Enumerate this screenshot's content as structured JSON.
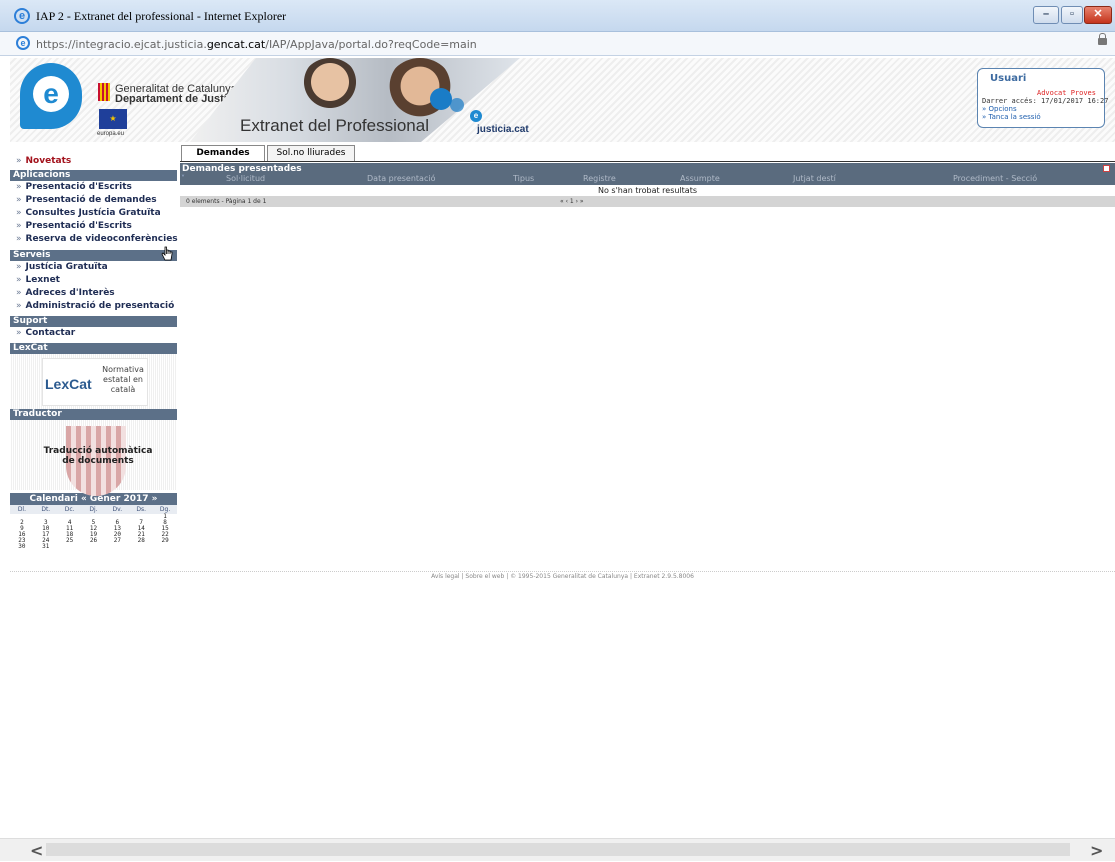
{
  "window": {
    "title": "IAP 2 - Extranet del professional - Internet Explorer",
    "url_prefix": "https://integracio.ejcat.justicia.",
    "url_domain": "gencat.cat",
    "url_suffix": "/IAP/AppJava/portal.do?reqCode=main",
    "minimize": "–",
    "maximize": "▫",
    "close": "✕"
  },
  "banner": {
    "logo_letter": "e",
    "gencat_line1": "Generalitat de Catalunya",
    "gencat_line2": "Departament de Justícia",
    "eu_label": "europa.eu",
    "title": "Extranet del Professional",
    "jcat": "justicia.cat"
  },
  "user": {
    "title": "Usuari",
    "name": "Advocat Proves",
    "last_access": "Darrer accés: 17/01/2017 16:27",
    "options": "» Opcions",
    "logout": "» Tanca la sessió"
  },
  "sidebar": {
    "novetats": "Novetats",
    "aplicacions_head": "Aplicacions",
    "aplicacions": [
      "Presentació d'Escrits",
      "Presentació de demandes",
      "Consultes Justícia Gratuïta",
      "Presentació d'Escrits",
      "Reserva de videoconferències"
    ],
    "serveis_head": "Serveis",
    "serveis": [
      "Justícia Gratuïta",
      "Lexnet",
      "Adreces d'Interès",
      "Administració de presentació"
    ],
    "suport_head": "Suport",
    "suport": [
      "Contactar"
    ],
    "lexcat_head": "LexCat",
    "lexcat_logo": "LexCat",
    "lexcat_text": "Normativa estatal en català",
    "traductor_head": "Traductor",
    "traductor_text": "Traducció automàtica de documents",
    "raquo": "»"
  },
  "calendar": {
    "title": "Calendari « Gener 2017 »",
    "days": [
      "Dl.",
      "Dt.",
      "Dc.",
      "Dj.",
      "Dv.",
      "Ds.",
      "Dg."
    ],
    "cells": [
      "",
      "",
      "",
      "",
      "",
      "",
      "1",
      "2",
      "3",
      "4",
      "5",
      "6",
      "7",
      "8",
      "9",
      "10",
      "11",
      "12",
      "13",
      "14",
      "15",
      "16",
      "17",
      "18",
      "19",
      "20",
      "21",
      "22",
      "23",
      "24",
      "25",
      "26",
      "27",
      "28",
      "29",
      "30",
      "31",
      "",
      "",
      "",
      "",
      ""
    ]
  },
  "main": {
    "tabs": [
      "Demandes",
      "Sol.no lliurades"
    ],
    "section_title": "Demandes presentades",
    "sort_icon": "˅",
    "columns": [
      "Sol·licitud",
      "Data presentació",
      "Tipus",
      "Registre",
      "Assumpte",
      "Jutjat destí",
      "Procediment - Secció"
    ],
    "no_results": "No s'han trobat resultats",
    "pager_left": "0 elements - Pàgina 1 de 1",
    "pager_center": "« ‹ 1 › »"
  },
  "footer": "Avís legal | Sobre el web | © 1995-2015 Generalitat de Catalunya | Extranet 2.9.5.8006",
  "scroll": {
    "left": "<",
    "right": ">"
  }
}
